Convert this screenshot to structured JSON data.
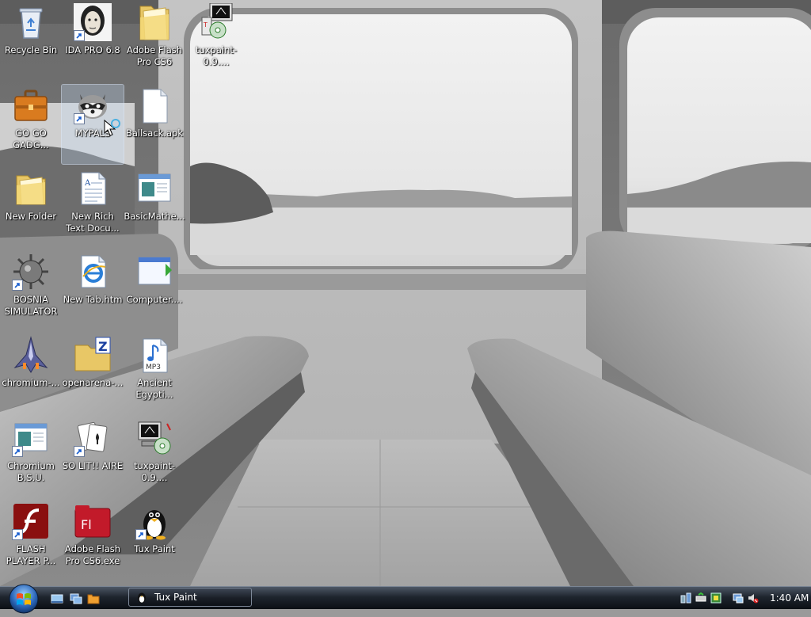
{
  "desktop": {
    "icons": [
      {
        "label": "Recycle Bin",
        "icon": "recycle-bin-icon"
      },
      {
        "label": "IDA PRO 6.8",
        "icon": "ida-pro-icon",
        "shortcut": true
      },
      {
        "label": "Adobe Flash Pro CS6",
        "icon": "folder-icon"
      },
      {
        "label": "tuxpaint-0.9....",
        "icon": "tuxpaint-installer-icon"
      },
      {
        "label": "GO GO GADG...",
        "icon": "briefcase-icon"
      },
      {
        "label": "MYPALS",
        "icon": "raccoon-icon",
        "shortcut": true,
        "selected": true
      },
      {
        "label": "Ballsack.apk",
        "icon": "blank-file-icon"
      },
      {
        "label": "New Folder",
        "icon": "folder-icon"
      },
      {
        "label": "New Rich Text Docu...",
        "icon": "rich-text-document-icon"
      },
      {
        "label": "BasicMathe...",
        "icon": "application-window-icon"
      },
      {
        "label": "BOSNIA SIMULATOR",
        "icon": "spiked-mine-icon",
        "shortcut": true
      },
      {
        "label": "New Tab.htm",
        "icon": "html-document-icon"
      },
      {
        "label": "Computer....",
        "icon": "application-window-icon"
      },
      {
        "label": "chromium-...",
        "icon": "spaceship-icon"
      },
      {
        "label": "openarena-...",
        "icon": "zip-folder-icon"
      },
      {
        "label": "Ancient Egypti...",
        "icon": "mp3-file-icon"
      },
      {
        "label": "Chromium B.S.U.",
        "icon": "application-window-icon",
        "shortcut": true
      },
      {
        "label": "SO LIT!! AIRE",
        "icon": "playing-cards-icon",
        "shortcut": true
      },
      {
        "label": "tuxpaint-0.9....",
        "icon": "tuxpaint-installer-icon"
      },
      {
        "label": "FLASH PLAYER P...",
        "icon": "flash-player-icon",
        "shortcut": true
      },
      {
        "label": "Adobe Flash Pro CS6.exe",
        "icon": "flash-pro-icon"
      },
      {
        "label": "Tux Paint",
        "icon": "tux-penguin-icon",
        "shortcut": true
      }
    ]
  },
  "taskbar": {
    "start": {
      "icon": "windows-start-orb-icon"
    },
    "quick_launch": [
      {
        "icon": "show-desktop-icon"
      },
      {
        "icon": "switch-windows-icon"
      },
      {
        "icon": "explorer-folder-icon"
      }
    ],
    "tasks": [
      {
        "label": "Tux Paint",
        "icon": "tux-penguin-icon",
        "active": true
      }
    ],
    "tray": {
      "icons": [
        "network-icon",
        "safely-remove-icon",
        "tray-app-icon",
        "monitor-network-icon",
        "volume-muted-icon"
      ],
      "clock": "1:40 AM"
    }
  }
}
